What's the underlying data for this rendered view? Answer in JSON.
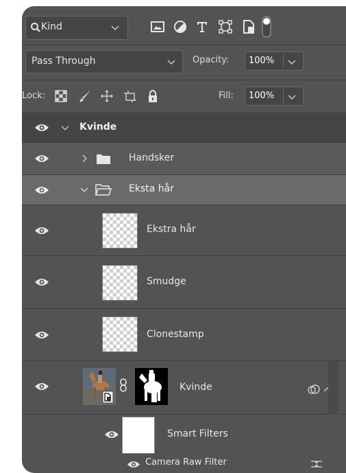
{
  "filter": {
    "kind_label": "Kind",
    "icons": [
      "image-filter-icon",
      "adjustment-filter-icon",
      "type-filter-icon",
      "shape-filter-icon",
      "smart-object-filter-icon",
      "filter-toggle-switch"
    ]
  },
  "blend": {
    "mode": "Pass Through",
    "opacity_label": "Opacity:",
    "opacity_value": "100%"
  },
  "lock": {
    "label": "Lock:",
    "fill_label": "Fill:",
    "fill_value": "100%"
  },
  "layers": {
    "group_kvinde": "Kvinde",
    "group_handsker": "Handsker",
    "group_eksta": "Eksta hår",
    "layer_ekstra": "Ekstra hår",
    "layer_smudge": "Smudge",
    "layer_clonestamp": "Clonestamp",
    "layer_kvinde": "Kvinde",
    "smart_filters": "Smart Filters",
    "camera_raw": "Camera Raw Filter"
  },
  "colors": {
    "panel_bg": "#535353",
    "selected_row": "#6a6a6a",
    "group_row": "#5a5a5a"
  }
}
